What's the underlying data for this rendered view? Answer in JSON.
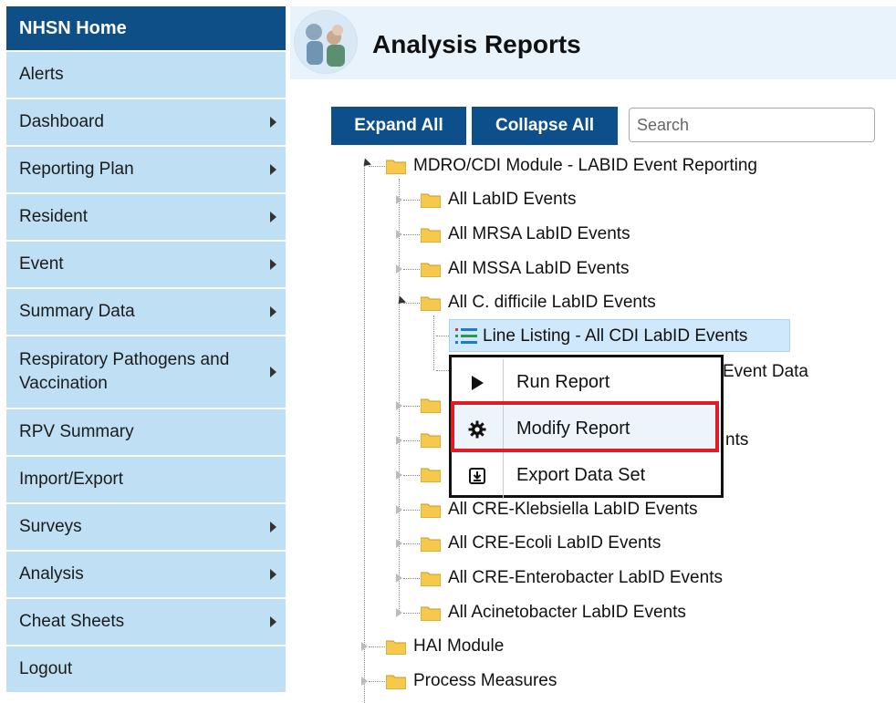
{
  "sidebar": {
    "home_label": "NHSN Home",
    "items": [
      {
        "label": "Alerts",
        "has_submenu": false
      },
      {
        "label": "Dashboard",
        "has_submenu": true
      },
      {
        "label": "Reporting Plan",
        "has_submenu": true
      },
      {
        "label": "Resident",
        "has_submenu": true
      },
      {
        "label": "Event",
        "has_submenu": true
      },
      {
        "label": "Summary Data",
        "has_submenu": true
      },
      {
        "label": "Respiratory Pathogens and Vaccination",
        "has_submenu": true
      },
      {
        "label": "RPV Summary",
        "has_submenu": false
      },
      {
        "label": "Import/Export",
        "has_submenu": false
      },
      {
        "label": "Surveys",
        "has_submenu": true
      },
      {
        "label": "Analysis",
        "has_submenu": true
      },
      {
        "label": "Cheat Sheets",
        "has_submenu": true
      },
      {
        "label": "Logout",
        "has_submenu": false
      }
    ]
  },
  "header": {
    "title": "Analysis Reports"
  },
  "toolbar": {
    "expand_label": "Expand All",
    "collapse_label": "Collapse All",
    "search_placeholder": "Search"
  },
  "tree": {
    "root": "MDRO/CDI Module - LABID Event Reporting",
    "children": [
      "All LabID Events",
      "All MRSA LabID Events",
      "All MSSA LabID Events",
      "All C. difficile LabID Events"
    ],
    "cdi_reports": [
      "Line Listing - All CDI LabID Events",
      "Event Data"
    ],
    "partial_after_menu": "nts",
    "more_children": [
      "All CRE-Klebsiella LabID Events",
      "All CRE-Ecoli LabID Events",
      "All CRE-Enterobacter LabID Events",
      "All Acinetobacter LabID Events"
    ],
    "modules": [
      "HAI Module",
      "Process Measures"
    ]
  },
  "context_menu": {
    "items": [
      {
        "label": "Run Report",
        "icon": "play-icon"
      },
      {
        "label": "Modify Report",
        "icon": "gear-icon"
      },
      {
        "label": "Export Data Set",
        "icon": "export-icon"
      }
    ],
    "selected": "Modify Report"
  },
  "colors": {
    "nav_home_bg": "#0e4f87",
    "nav_item_bg": "#bfdff5",
    "button_bg": "#0d4f8b",
    "highlight_border": "#e11b22"
  }
}
